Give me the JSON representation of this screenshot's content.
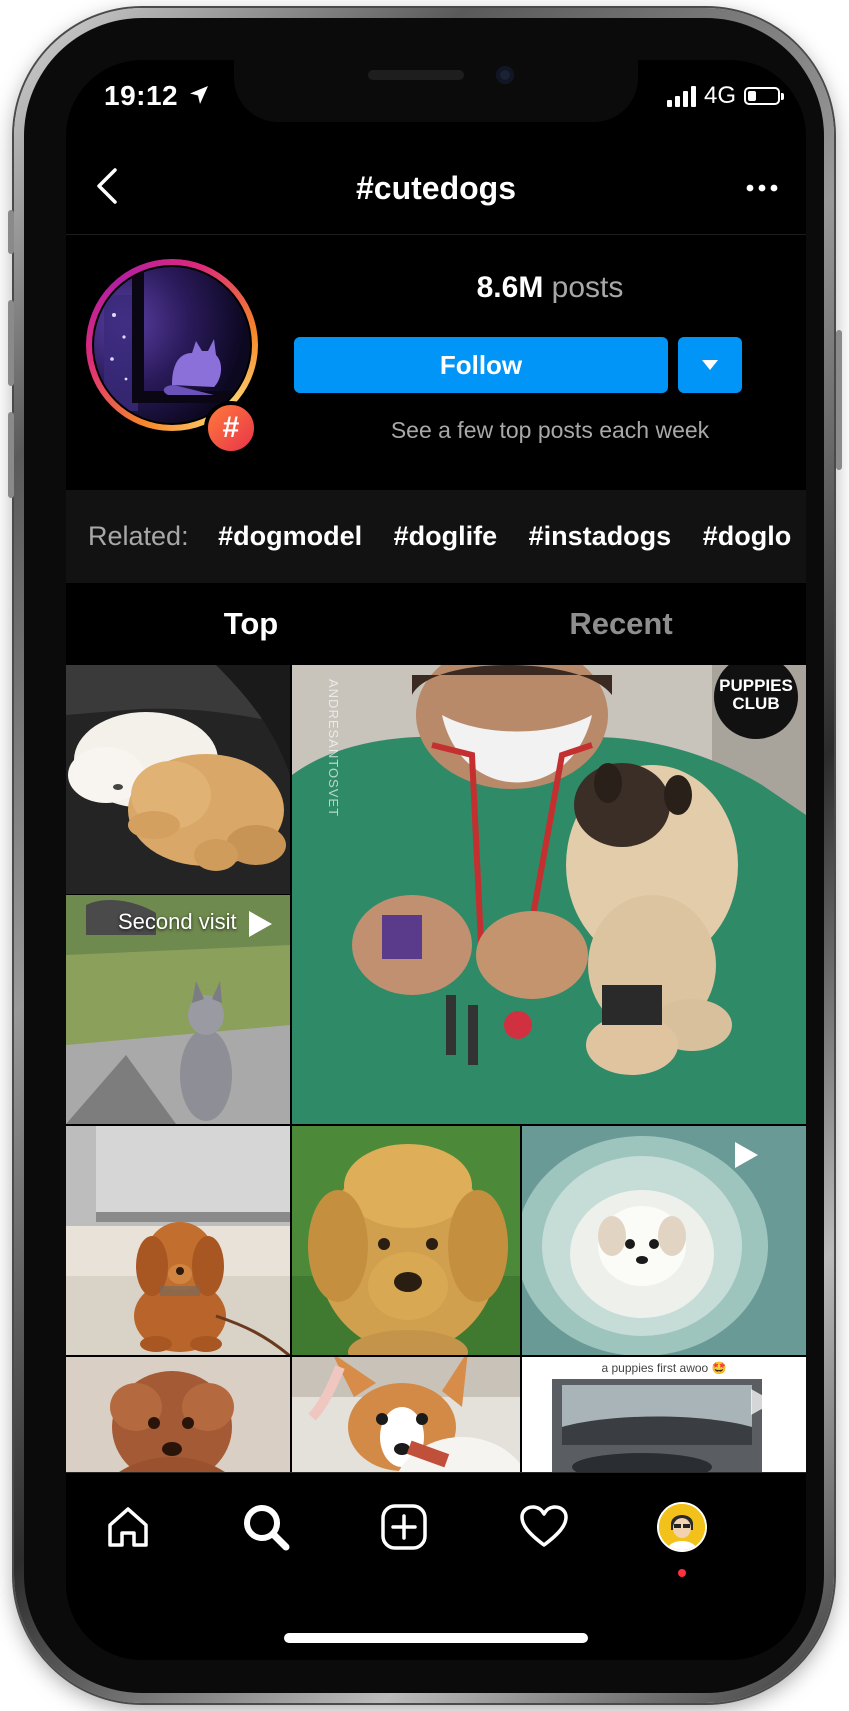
{
  "status_bar": {
    "time": "19:12",
    "network": "4G",
    "signal_bars": 4,
    "battery_level": 0.3
  },
  "header": {
    "title": "#cutedogs",
    "back_icon": "chevron-left-icon",
    "more_icon": "more-horizontal-icon"
  },
  "hashtag_profile": {
    "posts_count": "8.6M",
    "posts_label": "posts",
    "follow_label": "Follow",
    "subtitle": "See a few top posts each week",
    "badge_symbol": "#"
  },
  "related": {
    "label": "Related:",
    "tags": [
      "#dogmodel",
      "#doglife",
      "#instadogs",
      "#doglo"
    ]
  },
  "tabs": {
    "top": "Top",
    "recent": "Recent"
  },
  "grid": {
    "second_visit_caption": "Second visit",
    "brand_line1": "PUPPIES",
    "brand_line2": "CLUB",
    "vertical_watermark": "ANDRESANTOSVET",
    "last_tile_caption": "a puppies first awoo 🤩"
  },
  "bottom_nav": {
    "items": [
      "home-icon",
      "search-icon",
      "add-post-icon",
      "heart-icon",
      "profile-avatar"
    ]
  },
  "colors": {
    "accent": "#0095f6",
    "background": "#000000",
    "secondary_text": "#a8a8a8",
    "related_strip": "#121212",
    "notification_dot": "#ff3040"
  }
}
